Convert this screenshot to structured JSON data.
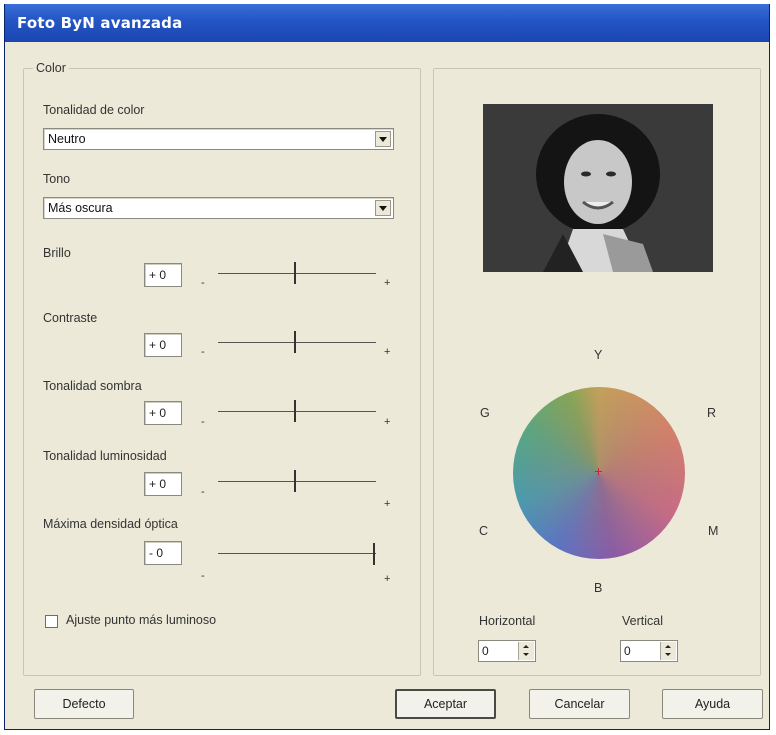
{
  "window": {
    "title": "Foto ByN avanzada"
  },
  "color_group": {
    "legend": "Color",
    "tonalidad_label": "Tonalidad de color",
    "tonalidad_value": "Neutro",
    "tono_label": "Tono",
    "tono_value": "Más oscura",
    "sliders": [
      {
        "label": "Brillo",
        "value": "+ 0",
        "level": 0.5
      },
      {
        "label": "Contraste",
        "value": "+ 0",
        "level": 0.5
      },
      {
        "label": "Tonalidad sombra",
        "value": "+ 0",
        "level": 0.5
      },
      {
        "label": "Tonalidad luminosidad",
        "value": "+ 0",
        "level": 0.5
      },
      {
        "label": "Máxima densidad óptica",
        "value": "- 0",
        "level": 1.0
      }
    ],
    "minus_sign": "-",
    "plus_sign": "+",
    "checkbox_label": "Ajuste punto más luminoso",
    "checkbox_checked": false
  },
  "preview": {
    "wheel_labels": {
      "top": "Y",
      "top_left": "G",
      "top_right": "R",
      "bottom_left": "C",
      "bottom_right": "M",
      "bottom": "B"
    },
    "horizontal_label": "Horizontal",
    "horizontal_value": "0",
    "vertical_label": "Vertical",
    "vertical_value": "0"
  },
  "buttons": {
    "defecto": "Defecto",
    "aceptar": "Aceptar",
    "cancelar": "Cancelar",
    "ayuda": "Ayuda"
  }
}
